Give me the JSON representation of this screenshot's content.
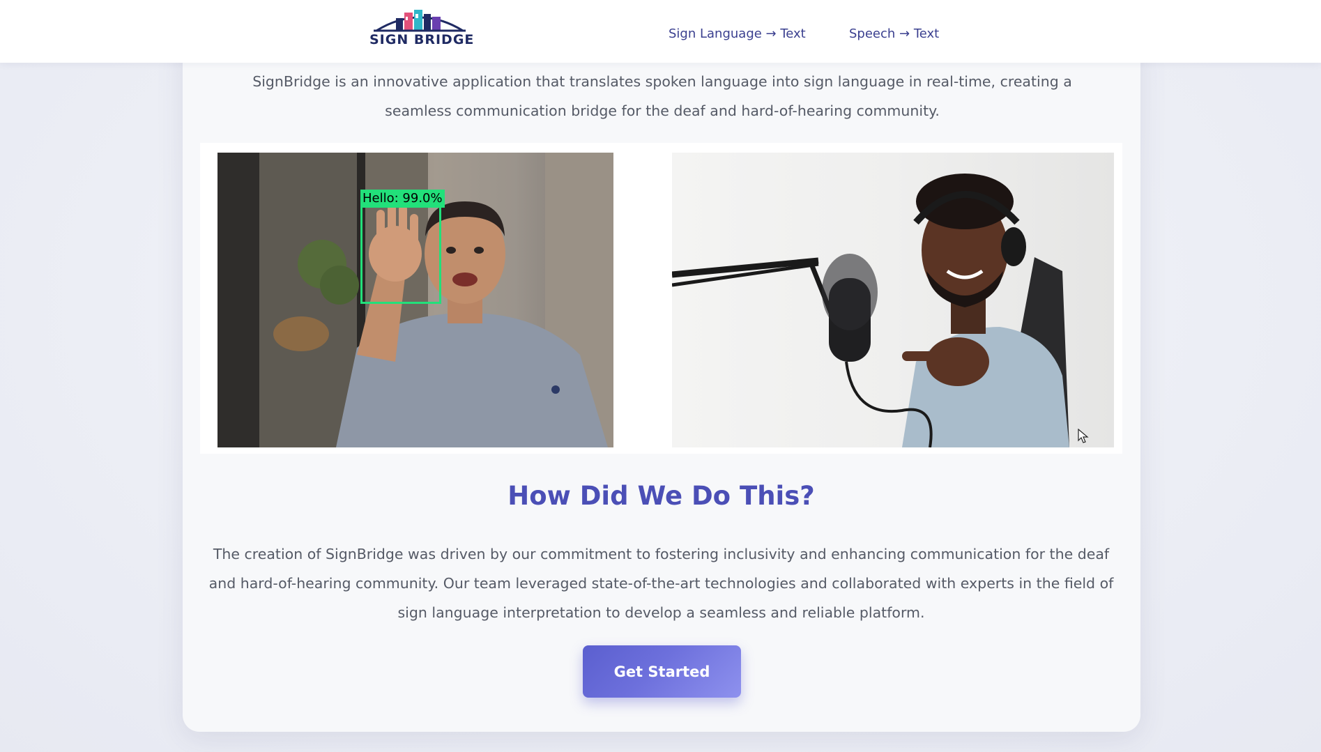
{
  "header": {
    "logo_text": "SIGN BRIDGE",
    "nav": [
      {
        "label": "Sign Language → Text"
      },
      {
        "label": "Speech → Text"
      }
    ]
  },
  "main": {
    "intro": "SignBridge is an innovative application that translates spoken language into sign language in real-time, creating a seamless communication bridge for the deaf and hard-of-hearing community.",
    "images": [
      {
        "detection_label": "Hello: 99.0%"
      },
      {}
    ],
    "section_title": "How Did We Do This?",
    "section_body": "The creation of SignBridge was driven by our commitment to fostering inclusivity and enhancing communication for the deaf and hard-of-hearing community. Our team leveraged state-of-the-art technologies and collaborated with experts in the field of sign language interpretation to develop a seamless and reliable platform.",
    "cta_label": "Get Started"
  },
  "colors": {
    "accent": "#4b4fb6",
    "nav_text": "#3a3f8f",
    "cta_start": "#5b5fcf",
    "cta_end": "#8e91ee",
    "detection": "#22e07a",
    "logo_dark": "#1f2a63"
  },
  "icons": {
    "logo": "sign-bridge-skyline-logo",
    "cursor": "mouse-pointer-icon"
  }
}
